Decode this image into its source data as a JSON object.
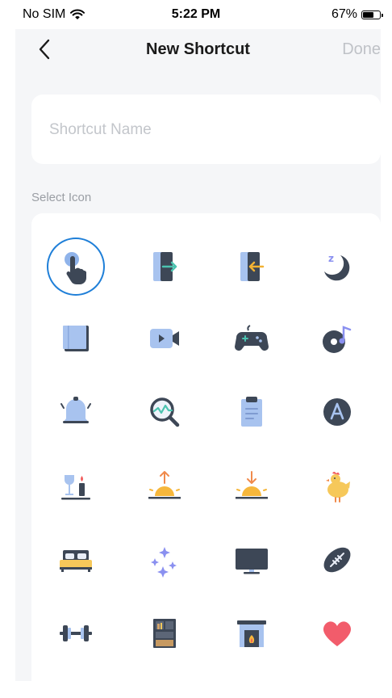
{
  "status": {
    "carrier": "No SIM",
    "time": "5:22 PM",
    "battery": "67%"
  },
  "nav": {
    "title": "New Shortcut",
    "done": "Done"
  },
  "name_field": {
    "placeholder": "Shortcut Name",
    "value": ""
  },
  "section": {
    "select_icon": "Select Icon"
  },
  "accent": "#1f7fd8",
  "icons": [
    "tap-hand-icon",
    "door-exit-icon",
    "door-enter-icon",
    "moon-sleep-icon",
    "book-icon",
    "video-camera-icon",
    "game-controller-icon",
    "music-record-icon",
    "bell-icon",
    "search-analytics-icon",
    "clipboard-icon",
    "letter-a-icon",
    "candle-wine-icon",
    "sunrise-icon",
    "sunset-icon",
    "chicken-icon",
    "bed-icon",
    "sparkles-icon",
    "tv-icon",
    "football-icon",
    "dumbbell-icon",
    "cabinet-icon",
    "fireplace-icon",
    "heart-icon"
  ],
  "selected_icon": "tap-hand-icon"
}
